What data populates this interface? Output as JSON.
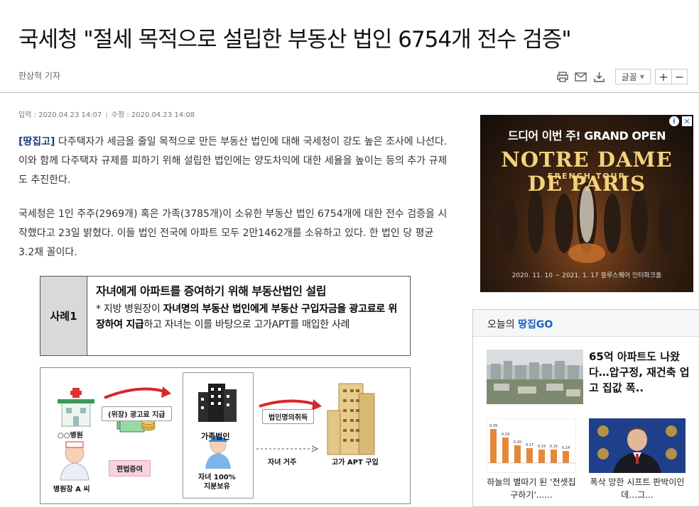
{
  "article": {
    "headline": "국세청 \"절세 목적으로 설립한 부동산 법인 6754개 전수 검증\"",
    "reporter": "한상혁 기자",
    "published_label": "입력 : 2020.04.23 14:07",
    "updated_label": "수정 : 2020.04.23 14:08",
    "paragraph1_tag": "[땅집고]",
    "paragraph1": "다주택자가 세금을 줄일 목적으로 만든 부동산 법인에 대해 국세청이 강도 높은 조사에 나선다. 이와 함께 다주택자 규제를 피하기 위해 설립한 법인에는 양도차익에 대한 세율을 높이는 등의 추가 규제도 추진한다.",
    "paragraph2": "국세청은 1인 주주(2969개) 혹은 가족(3785개)이 소유한 부동산 법인 6754개에 대한 전수 검증을 시작했다고 23일 밝혔다. 이들 법인 전국에 아파트 모두 2만1462개를 소유하고 있다. 한 법인 당 평균 3.2채 꼴이다."
  },
  "toolbar": {
    "print_icon": "printer-icon",
    "mail_icon": "mail-icon",
    "save_icon": "download-icon",
    "font_label": "글꼴",
    "zoom_in": "+",
    "zoom_out": "−"
  },
  "case": {
    "label": "사례1",
    "title": "자녀에게 아파트를 증여하기 위해 부동산법인 설립",
    "bullet": "*",
    "text_pre": "지방 병원장이 ",
    "text_bold": "자녀명의 부동산 법인에게 부동산 구입자금을 광고료로 위장하여 지급",
    "text_post": "하고 자녀는 이를 바탕으로 고가APT를 매입한 사례"
  },
  "diagram": {
    "hospital": "○○병원",
    "director": "병원장 A 씨",
    "ad_fee": "(위장) 광고료 지급",
    "gift": "편법증여",
    "family_corp": "가족법인",
    "child_share": "자녀 100%\n지분보유",
    "acquire": "법인명의취득",
    "residence": "자녀 거주",
    "purchase": "고가 APT 구입"
  },
  "ad": {
    "top_text": "드디어 이번 주! GRAND OPEN",
    "main_title": "NOTRE DAME DE PARIS",
    "subtitle": "FRENCH TOUR",
    "date_text": "2020. 11. 10 ~ 2021. 1. 17  블루스퀘어 인터파크홀",
    "info_label": "i",
    "close_label": "✕"
  },
  "widget": {
    "heading_prefix": "오늘의 ",
    "heading_brand": "땅집GO",
    "item1_title": "65억 아파트도 나왔다…압구정, 재건축 업고 집값 폭..",
    "item2_title": "하늘의 별따기 된 '전셋집 구하기'......",
    "item3_title": "폭삭 망한 시프트 판박이인데…그...",
    "item2_chart_values": [
      "0.39",
      "0.29",
      "0.20",
      "0.17",
      "0.15",
      "0.15",
      "0.14"
    ]
  }
}
